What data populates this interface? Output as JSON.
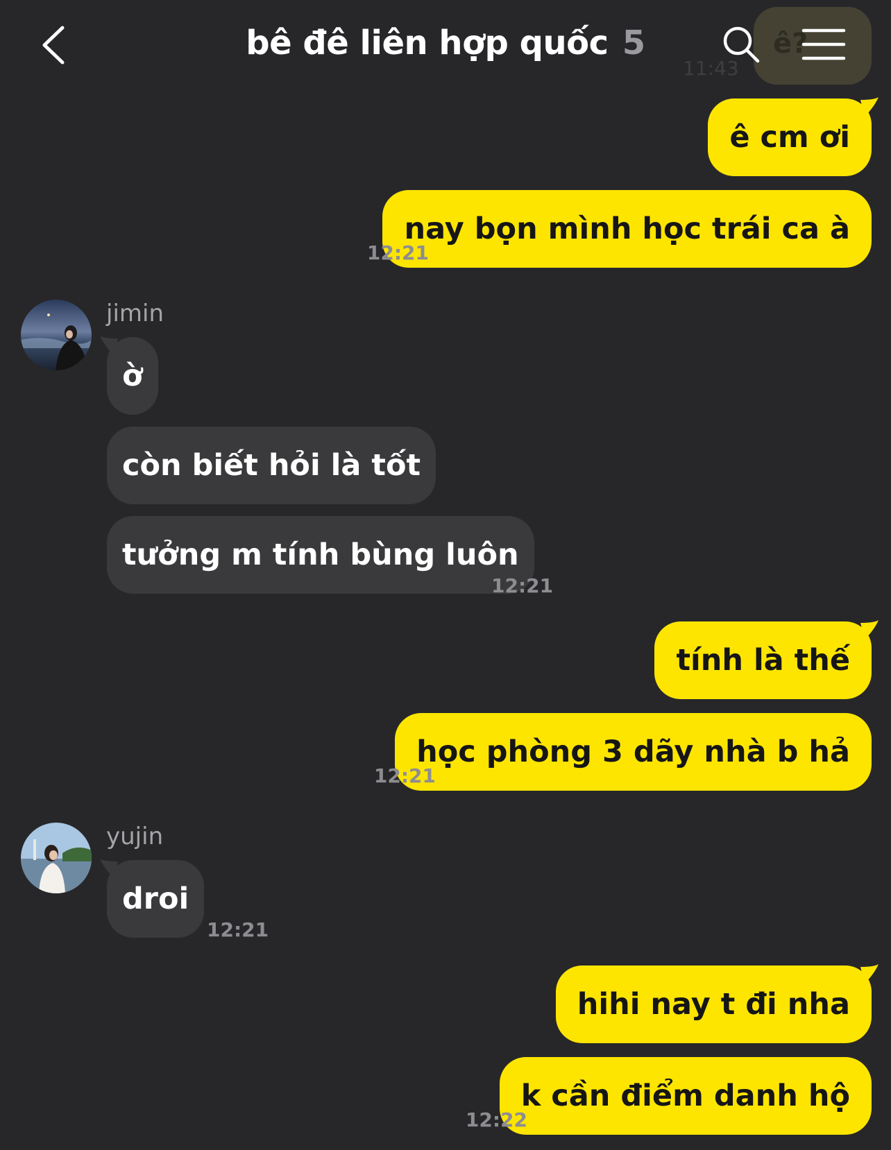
{
  "header": {
    "title": "bê đê liên hợp quốc",
    "member_count": "5",
    "back_icon": "chevron-left-icon",
    "search_icon": "search-icon",
    "menu_icon": "hamburger-menu-icon"
  },
  "peek": {
    "text": "ê?",
    "time": "11:43"
  },
  "messages": [
    {
      "text": "ê cm ơi"
    },
    {
      "text": "nay bọn mình học trái ca à",
      "time": "12:21"
    },
    {
      "sender": "jimin",
      "text": "ờ"
    },
    {
      "text": "còn biết hỏi là tốt"
    },
    {
      "text": "tưởng m tính bùng luôn",
      "time": "12:21"
    },
    {
      "text": "tính là thế"
    },
    {
      "text": "học phòng 3 dãy nhà b hả",
      "time": "12:21"
    },
    {
      "sender": "yujin",
      "text": "droi",
      "time": "12:21"
    },
    {
      "text": "hihi nay t đi nha"
    },
    {
      "text": "k cần điểm danh hộ",
      "time": "12:22"
    }
  ],
  "colors": {
    "background": "#27272a",
    "my_bubble": "#fee500",
    "their_bubble": "#3a3a3c"
  }
}
